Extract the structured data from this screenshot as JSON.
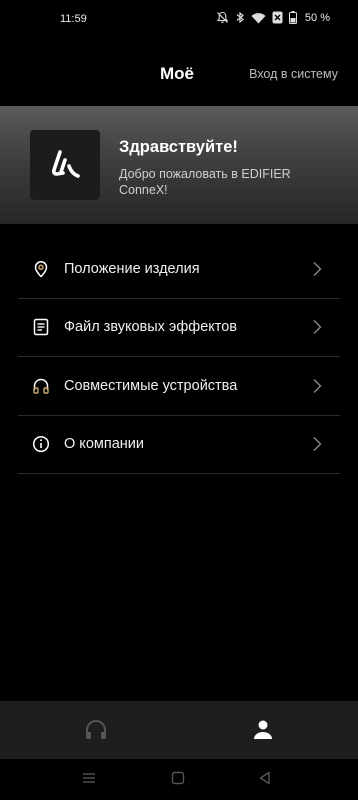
{
  "status_bar": {
    "time": "11:59",
    "battery": "50 %",
    "icons": [
      "mute-icon",
      "bluetooth-icon",
      "wifi-icon",
      "no-sim-icon",
      "battery-icon"
    ]
  },
  "header": {
    "title": "Моё",
    "login_label": "Вход в систему"
  },
  "profile": {
    "greeting": "Здравствуйте!",
    "welcome": "Добро пожаловать в EDIFIER ConneX!",
    "logo_icon": "edifier-logo-icon"
  },
  "menu": {
    "items": [
      {
        "label": "Положение изделия",
        "icon": "location-pin-icon"
      },
      {
        "label": "Файл звуковых эффектов",
        "icon": "document-icon"
      },
      {
        "label": "Совместимые устройства",
        "icon": "headphones-icon"
      },
      {
        "label": "О компании",
        "icon": "info-icon"
      }
    ]
  },
  "bottom_nav": {
    "tabs": [
      {
        "icon": "headphones-icon",
        "active": false
      },
      {
        "icon": "person-icon",
        "active": true
      }
    ]
  },
  "system_nav": {
    "buttons": [
      "recents-icon",
      "home-icon",
      "back-icon"
    ]
  },
  "colors": {
    "background": "#000000",
    "card_top": "#5a5a5a",
    "card_bottom": "#262626",
    "text_primary": "#ffffff",
    "text_secondary": "#bdbdbd",
    "accent_gold": "#c9a66b",
    "nav_bar": "#1e1e1e"
  }
}
